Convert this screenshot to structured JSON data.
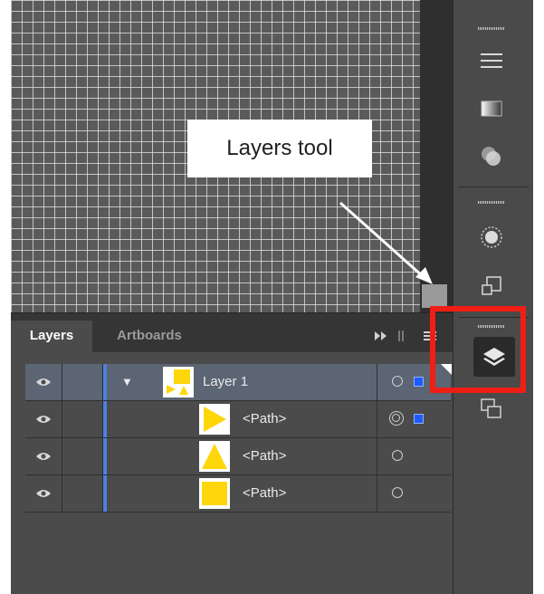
{
  "callout": {
    "text": "Layers tool"
  },
  "panel": {
    "tabs": [
      {
        "label": "Layers",
        "active": true
      },
      {
        "label": "Artboards",
        "active": false
      }
    ],
    "rows": [
      {
        "name": "Layer 1",
        "thumbnail": "layer-thumbnail",
        "selected": true,
        "expanded": true
      },
      {
        "name": "<Path>",
        "thumbnail": "triangle-right-shape",
        "selected": false
      },
      {
        "name": "<Path>",
        "thumbnail": "triangle-up-shape",
        "selected": false
      },
      {
        "name": "<Path>",
        "thumbnail": "square-shape",
        "selected": false
      }
    ]
  },
  "dock": {
    "icons": [
      "stroke-panel-icon",
      "gradient-panel-icon",
      "transparency-panel-icon",
      "appearance-panel-icon",
      "transform-panel-icon",
      "layers-panel-icon",
      "artboards-panel-icon"
    ]
  },
  "colors": {
    "highlight": "#f01e14",
    "layer_color": "#4d7fe0",
    "shape_fill": "#ffd60a",
    "selection": "#1e5bff"
  }
}
